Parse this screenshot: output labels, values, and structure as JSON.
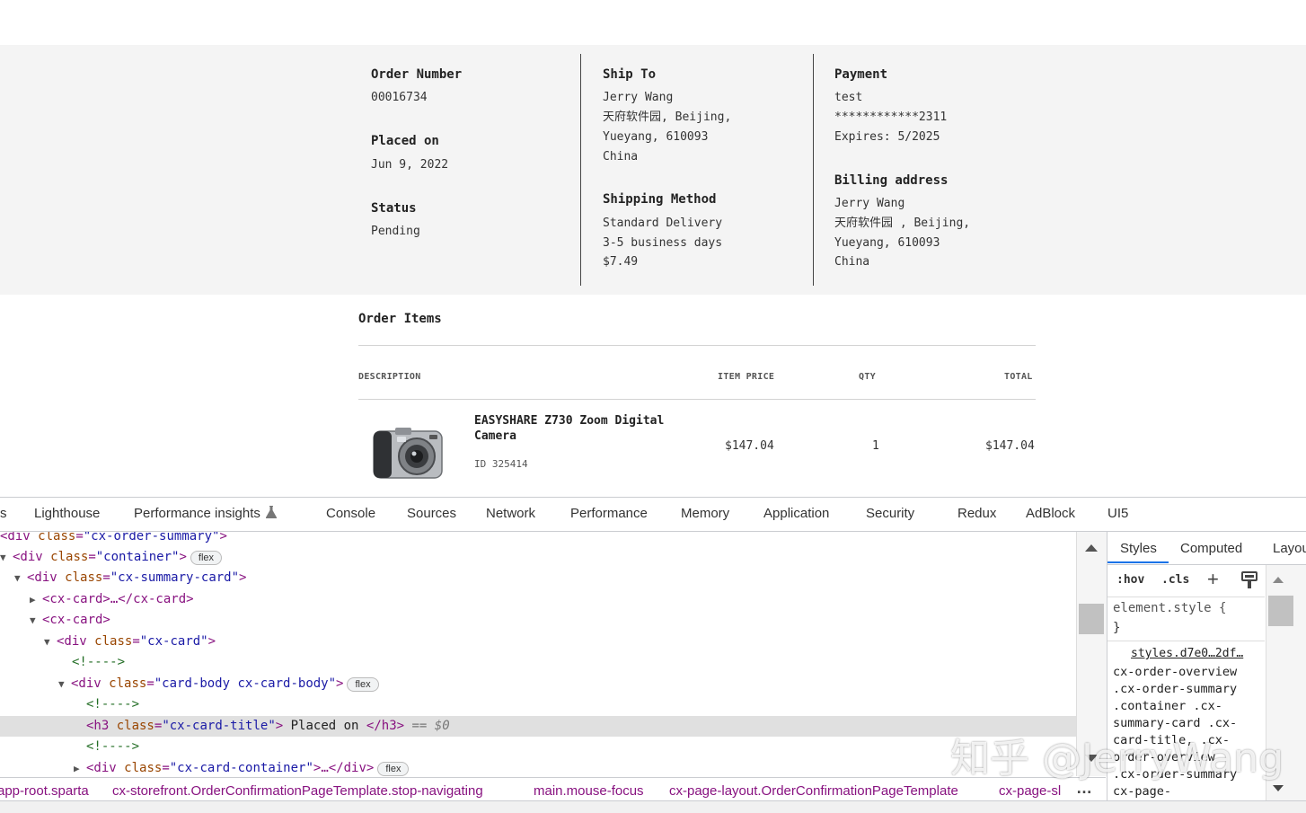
{
  "summary": {
    "order_number_label": "Order Number",
    "order_number": "00016734",
    "placed_on_label": "Placed on",
    "placed_on": "Jun 9, 2022",
    "status_label": "Status",
    "status": "Pending",
    "ship_to_label": "Ship To",
    "ship_to_lines": [
      "Jerry Wang",
      "天府软件园, Beijing,",
      "Yueyang, 610093",
      "China"
    ],
    "shipping_method_label": "Shipping Method",
    "shipping_method_lines": [
      "Standard Delivery",
      "3-5 business days",
      "$7.49"
    ],
    "payment_label": "Payment",
    "payment_lines": [
      "test",
      "************2311",
      "Expires: 5/2025"
    ],
    "billing_label": "Billing address",
    "billing_lines": [
      "Jerry Wang",
      "天府软件园 , Beijing,",
      "Yueyang, 610093",
      "China"
    ]
  },
  "order_items": {
    "title": "Order Items",
    "headers": {
      "description": "DESCRIPTION",
      "item_price": "ITEM PRICE",
      "qty": "QTY",
      "total": "TOTAL"
    },
    "item": {
      "name_line1": "EASYSHARE Z730 Zoom Digital",
      "name_line2": "Camera",
      "id": "ID 325414",
      "price": "$147.04",
      "qty": "1",
      "total": "$147.04"
    }
  },
  "devtools": {
    "tabs": [
      "s",
      "Lighthouse",
      "Performance insights",
      "Console",
      "Sources",
      "Network",
      "Performance",
      "Memory",
      "Application",
      "Security",
      "Redux",
      "AdBlock",
      "UI5"
    ],
    "elements": {
      "l0": {
        "open": "<div ",
        "attr": "class",
        "val": "\"cx-order-summary\"",
        "close": ">"
      },
      "l1": {
        "open": "<div ",
        "attr": "class",
        "val": "\"container\"",
        "close": ">",
        "badge": "flex"
      },
      "l2": {
        "open": "<div ",
        "attr": "class",
        "val": "\"cx-summary-card\"",
        "close": ">"
      },
      "l3": {
        "text": "<cx-card>…</cx-card>"
      },
      "l4": {
        "text": "<cx-card>"
      },
      "l5": {
        "open": "<div ",
        "attr": "class",
        "val": "\"cx-card\"",
        "close": ">"
      },
      "l6": {
        "text": "<!---->"
      },
      "l7": {
        "open": "<div ",
        "attr": "class",
        "val": "\"card-body cx-card-body\"",
        "close": ">",
        "badge": "flex"
      },
      "l8": {
        "text": "<!---->"
      },
      "l9": {
        "open": "<h3 ",
        "attr": "class",
        "val": "\"cx-card-title\"",
        "close": ">",
        "content": " Placed on ",
        "end": "</h3>",
        "suffix": " == $0"
      },
      "l10": {
        "text": "<!---->"
      },
      "l11": {
        "open": "<div ",
        "attr": "class",
        "val": "\"cx-card-container\"",
        "close": ">…</div>",
        "badge": "flex"
      }
    },
    "styles_tabs": [
      "Styles",
      "Computed",
      "Layou"
    ],
    "toolbar": {
      "hov": ":hov",
      "cls": ".cls",
      "plus": "+"
    },
    "element_style": "element.style {",
    "close_brace": "}",
    "stylesheet_link": "styles.d7e0…2df…",
    "selector_lines": [
      "cx-order-overview",
      ".cx-order-summary",
      ".container .cx-",
      "summary-card .cx-",
      "card-title, .cx-",
      "order-overview",
      ".cx-order-summary",
      "cx-page-"
    ],
    "breadcrumbs": [
      "app-root.sparta",
      "cx-storefront.OrderConfirmationPageTemplate.stop-navigating",
      "main.mouse-focus",
      "cx-page-layout.OrderConfirmationPageTemplate",
      "cx-page-sl"
    ],
    "more": "…"
  },
  "watermark": "知乎 @JerryWang"
}
